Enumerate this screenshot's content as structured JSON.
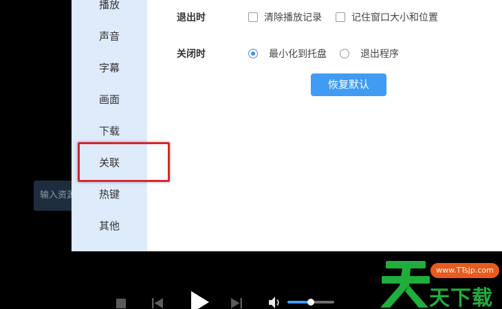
{
  "sidebar": {
    "items": [
      {
        "label": "播放"
      },
      {
        "label": "声音"
      },
      {
        "label": "字幕"
      },
      {
        "label": "画面"
      },
      {
        "label": "下载"
      },
      {
        "label": "关联"
      },
      {
        "label": "热键"
      },
      {
        "label": "其他"
      }
    ],
    "highlighted_item": "关联"
  },
  "settings": {
    "exit_row": {
      "label": "退出时",
      "options": [
        {
          "label": "清除播放记录",
          "checked": false
        },
        {
          "label": "记住窗口大小和位置",
          "checked": false
        }
      ]
    },
    "close_row": {
      "label": "关闭时",
      "options": [
        {
          "label": "最小化到托盘",
          "selected": true
        },
        {
          "label": "退出程序",
          "selected": false
        }
      ]
    },
    "restore_button": "恢复默认"
  },
  "background": {
    "input_placeholder": "输入资源"
  },
  "player": {
    "volume_level": 0.5
  },
  "watermark": {
    "url": "www.TTsjp.com",
    "text": "天下载",
    "logo_char": "天"
  },
  "colors": {
    "accent": "#3f9cf2",
    "sidebar_bg": "#deebfb",
    "highlight_border": "#d8262c",
    "watermark_green": "#1fad3c",
    "watermark_orange": "#ea5a1d"
  }
}
